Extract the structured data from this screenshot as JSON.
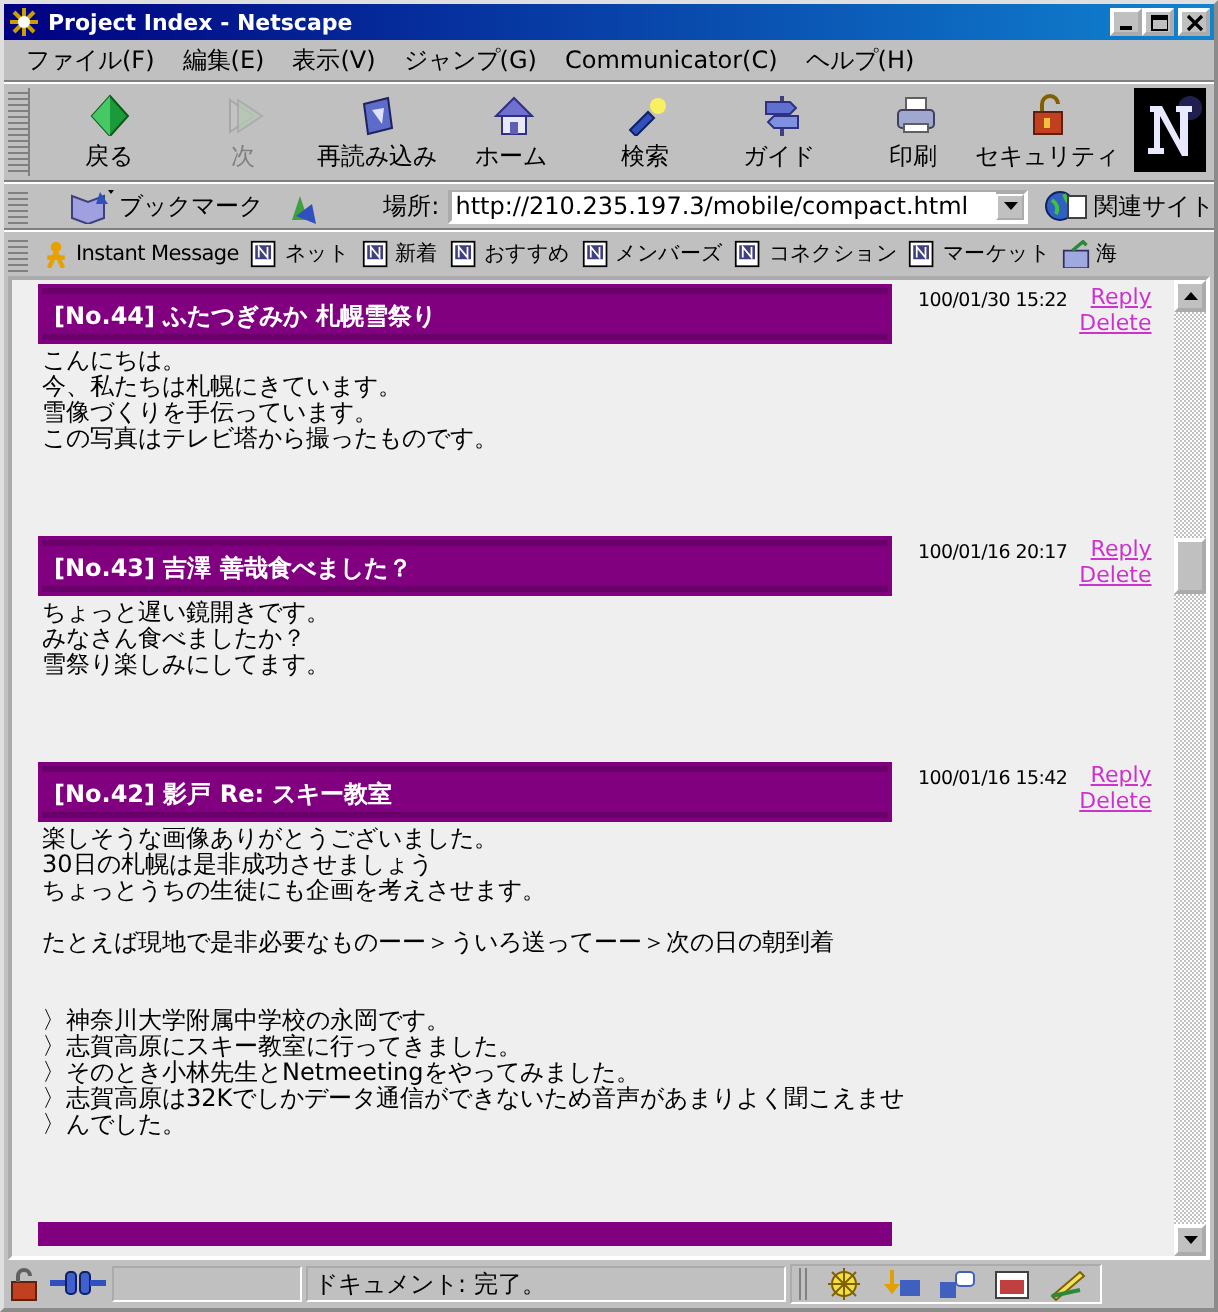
{
  "window": {
    "title": "Project Index - Netscape"
  },
  "menu": [
    "ファイル(F)",
    "編集(E)",
    "表示(V)",
    "ジャンプ(G)",
    "Communicator(C)",
    "ヘルプ(H)"
  ],
  "toolbar": [
    {
      "label": "戻る",
      "disabled": false
    },
    {
      "label": "次",
      "disabled": true
    },
    {
      "label": "再読み込み",
      "disabled": false
    },
    {
      "label": "ホーム",
      "disabled": false
    },
    {
      "label": "検索",
      "disabled": false
    },
    {
      "label": "ガイド",
      "disabled": false
    },
    {
      "label": "印刷",
      "disabled": false
    },
    {
      "label": "セキュリティ",
      "disabled": false
    }
  ],
  "location": {
    "bookmarks": "ブックマーク",
    "label": "場所:",
    "url": "http://210.235.197.3/mobile/compact.html",
    "related": "関連サイト"
  },
  "personal_toolbar": [
    {
      "label": "Instant Message",
      "kind": "person"
    },
    {
      "label": "ネット",
      "kind": "page"
    },
    {
      "label": "新着",
      "kind": "page"
    },
    {
      "label": "おすすめ",
      "kind": "page"
    },
    {
      "label": "メンバーズ",
      "kind": "page"
    },
    {
      "label": "コネクション",
      "kind": "page"
    },
    {
      "label": "マーケット",
      "kind": "page"
    },
    {
      "label": "海",
      "kind": "folder"
    }
  ],
  "posts": [
    {
      "title": "[No.44] ふたつぎみか 札幌雪祭り",
      "date": "100/01/30 15:22",
      "reply": "Reply",
      "delete": "Delete",
      "paragraphs": [
        {
          "kind": "text",
          "lines": [
            "こんにちは。",
            "今、私たちは札幌にきています。",
            "雪像づくりを手伝っています。",
            "この写真はテレビ塔から撮ったものです。"
          ]
        }
      ]
    },
    {
      "title": "[No.43] 吉澤 善哉食べました？",
      "date": "100/01/16 20:17",
      "reply": "Reply",
      "delete": "Delete",
      "paragraphs": [
        {
          "kind": "text",
          "lines": [
            "ちょっと遅い鏡開きです。",
            "みなさん食べましたか？",
            "雪祭り楽しみにしてます。"
          ]
        }
      ]
    },
    {
      "title": "[No.42] 影戸 Re: スキー教室",
      "date": "100/01/16 15:42",
      "reply": "Reply",
      "delete": "Delete",
      "paragraphs": [
        {
          "kind": "text",
          "lines": [
            "楽しそうな画像ありがとうございました。",
            "30日の札幌は是非成功させましょう",
            "ちょっとうちの生徒にも企画を考えさせます。"
          ]
        },
        {
          "kind": "text",
          "lines": [
            "たとえば現地で是非必要なものーー＞ういろ送ってーー＞次の日の朝到着"
          ]
        },
        {
          "kind": "quote",
          "lines": [
            "〉神奈川大学附属中学校の永岡です。",
            "〉志賀高原にスキー教室に行ってきました。",
            "〉そのとき小林先生とNetmeetingをやってみました。",
            "〉志賀高原は32Kでしかデータ通信ができないため音声があまりよく聞こえませ",
            "〉んでした。"
          ]
        }
      ]
    }
  ],
  "more_posts_below": true,
  "status_bar": {
    "text": "ドキュメント: 完了。"
  }
}
